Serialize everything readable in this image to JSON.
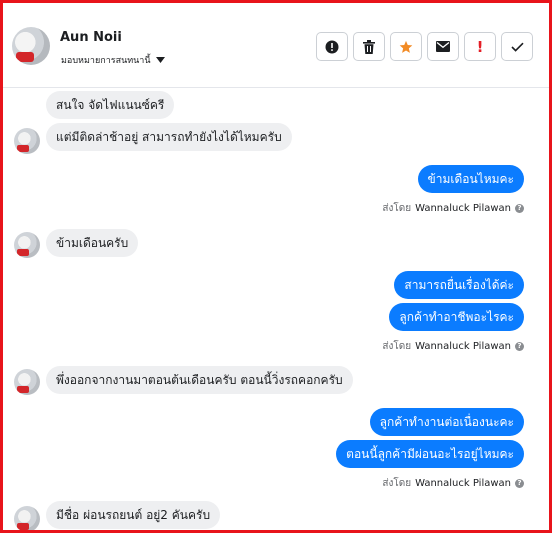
{
  "header": {
    "contact_name": "Aun Noii",
    "assign_label": "มอบหมายการสนทนานี้"
  },
  "messages": [
    {
      "dir": "in",
      "text": "สนใจ จัดไฟแนนซ์ครี"
    },
    {
      "dir": "in",
      "text": "แต่มีติดล่าช้าอยู่  สามารถทำยังไงได้ไหมครับ"
    },
    {
      "dir": "out",
      "text": "ข้ามเดือนไหมคะ"
    },
    {
      "dir": "in",
      "text": "ข้ามเดือนครับ"
    },
    {
      "dir": "out",
      "text": "สามารถยื่นเรื่องได้ค่ะ"
    },
    {
      "dir": "out",
      "text": "ลูกค้าทำอาชีพอะไรคะ"
    },
    {
      "dir": "in",
      "text": "พึ่งออกจากงานมาตอนต้นเดือนครับ   ตอนนี้วิ่งรถคอกครับ"
    },
    {
      "dir": "out",
      "text": "ลูกค้าทำงานต่อเนื่องนะคะ"
    },
    {
      "dir": "out",
      "text": "ตอนนี้ลูกค้ามีผ่อนอะไรอยู่ไหมคะ"
    },
    {
      "dir": "in",
      "text": "มีชื่อ ผ่อนรถยนต์ อยู่2 คันครับ"
    }
  ],
  "sent_by": {
    "prefix": "ส่งโดย",
    "name": "Wannaluck Pilawan",
    "info": "?"
  },
  "colors": {
    "frame": "#e8141b",
    "outgoing": "#0b7cff",
    "incoming": "#eeeff1",
    "star": "#f28b25",
    "alert": "#e41e26"
  },
  "icons": [
    "alert-circle-icon",
    "trash-icon",
    "star-icon",
    "mail-icon",
    "exclamation-icon",
    "check-icon",
    "chevron-down-icon"
  ]
}
